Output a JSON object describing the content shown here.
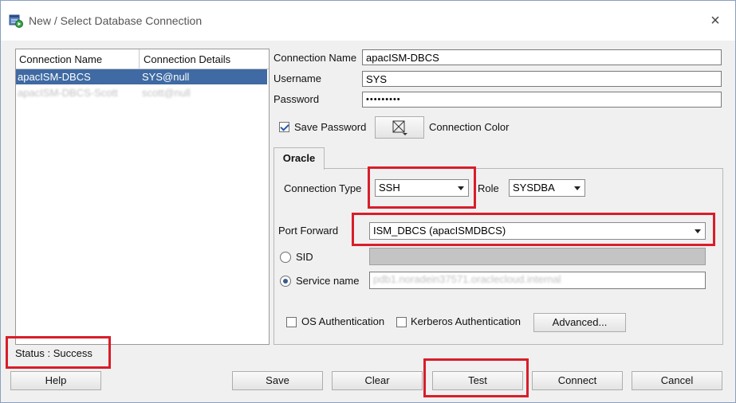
{
  "window": {
    "title": "New / Select Database Connection",
    "close_glyph": "×"
  },
  "connections": {
    "headers": [
      "Connection Name",
      "Connection Details"
    ],
    "rows": [
      {
        "name": "apacISM-DBCS",
        "details": "SYS@null",
        "selected": true
      },
      {
        "name": "apacISM-DBCS-Scott",
        "details": "scott@null",
        "selected": false
      }
    ]
  },
  "form": {
    "connection_name_label": "Connection Name",
    "connection_name_value": "apacISM-DBCS",
    "username_label": "Username",
    "username_value": "SYS",
    "password_label": "Password",
    "password_value": "•••••••••",
    "save_password_label": "Save Password",
    "save_password_checked": true,
    "connection_color_label": "Connection Color"
  },
  "tab": {
    "label": "Oracle",
    "connection_type_label": "Connection Type",
    "connection_type_value": "SSH",
    "role_label": "Role",
    "role_value": "SYSDBA",
    "port_forward_label": "Port Forward",
    "port_forward_value": "ISM_DBCS (apacISMDBCS)",
    "sid_label": "SID",
    "service_name_label": "Service name",
    "service_name_value": "pdb1.noradein37571.oraclecloud.internal",
    "os_auth_label": "OS Authentication",
    "kerberos_auth_label": "Kerberos Authentication",
    "advanced_label": "Advanced..."
  },
  "status": {
    "text": "Status : Success"
  },
  "buttons": {
    "help": "Help",
    "save": "Save",
    "clear": "Clear",
    "test": "Test",
    "connect": "Connect",
    "cancel": "Cancel"
  },
  "colors": {
    "selection": "#3f6aa3",
    "highlight": "#d81e2a"
  }
}
